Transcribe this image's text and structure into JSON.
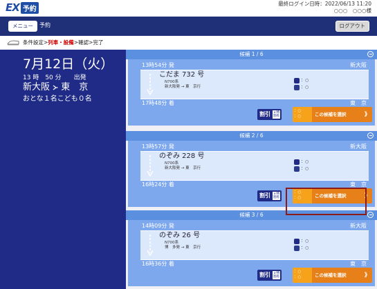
{
  "header": {
    "logo_ex": "EX",
    "logo_yoyaku": "予約",
    "last_login_label": "最終ログイン日時：2022/06/13 11:20",
    "user_name": "○○○　○○○様"
  },
  "navbar": {
    "menu_label": "メニュー",
    "title": "予約",
    "logout_label": "ログアウト"
  },
  "breadcrumb": {
    "step1": "条件設定>",
    "step2_current": "列車・設備",
    "step3": ">確認>完了"
  },
  "summary": {
    "date": "7月12日（火）",
    "time": "13 時　50 分　　出発",
    "from": "新大阪",
    "to": "東　京",
    "passengers": "おとな１名こども０名"
  },
  "candidates": [
    {
      "header": "候補 1 / 6",
      "dep_time": "13時54分 発",
      "dep_station": "新大阪",
      "train_name": "こだま 732 号",
      "train_class": "N700系",
      "route": "新大阪発 → 東　京行",
      "seat_reserved": "：○",
      "seat_green": "：○",
      "arr_time": "17時48分 着",
      "arr_station": "東　京",
      "discount_label": "割引",
      "discount_sub": "ｅ特\n割有",
      "select_label": "この候補を選択",
      "select_seat1": "：○",
      "select_seat2": "：○"
    },
    {
      "header": "候補 2 / 6",
      "dep_time": "13時57分 発",
      "dep_station": "新大阪",
      "train_name": "のぞみ 228 号",
      "train_class": "N700系",
      "route": "新大阪発 → 東　京行",
      "seat_reserved": "：○",
      "seat_green": "：○",
      "arr_time": "16時24分 着",
      "arr_station": "東　京",
      "discount_label": "割引",
      "discount_sub": "ｅ特\n割有",
      "select_label": "この候補を選択",
      "select_seat1": "：○",
      "select_seat2": "：○"
    },
    {
      "header": "候補 3 / 6",
      "dep_time": "14時09分 発",
      "dep_station": "新大阪",
      "train_name": "のぞみ 26 号",
      "train_class": "N700系",
      "route": "博　多発 → 東　京行",
      "seat_reserved": "：○",
      "seat_green": "：○",
      "arr_time": "16時36分 着",
      "arr_station": "東　京",
      "discount_label": "割引",
      "discount_sub": "ｅ特\n割有",
      "select_label": "この候補を選択",
      "select_seat1": "：○",
      "select_seat2": "：○"
    }
  ],
  "colors": {
    "navy": "#1f2b86",
    "header_blue": "#5b8fe0",
    "card_blue": "#7ea8ee",
    "select_orange": "#e8801a",
    "highlight": "#8b1a1a"
  }
}
